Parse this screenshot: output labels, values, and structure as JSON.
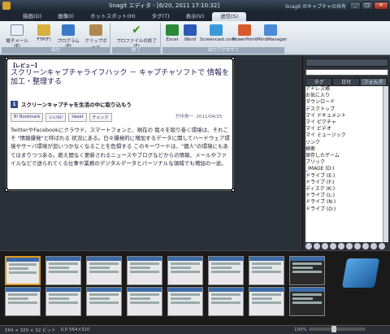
{
  "window": {
    "title": "Snagit エディタ - [6/20, 2011 17:10:32]",
    "right_text": "Snagit のキャプチャの共有",
    "minimize": "_",
    "maximize": "□",
    "close": "✕"
  },
  "tabs": [
    "描画(D)",
    "画像(I)",
    "ホットスポット(H)",
    "タグ(T)",
    "表示(V)",
    "送信(S)"
  ],
  "ribbon": {
    "groups": [
      {
        "label": "出力",
        "buttons": [
          "電子メール(E)",
          "FTP(F)",
          "プログラム(P)",
          "クリップボード"
        ]
      },
      {
        "label": "終了",
        "buttons": [
          "プロファイルの終了(F)"
        ]
      },
      {
        "label": "出力アクセサリ",
        "buttons": [
          "Excel",
          "Word",
          "Screencast.com",
          "PowerPoint",
          "MindManager"
        ]
      }
    ]
  },
  "document": {
    "tag": "【レビュー】",
    "title": "スクリーンキャプチャライフハック － キャプチャソフトで 情報を加工・整理する",
    "section_num": "1",
    "section": "スクリーンキャプチャを生活の中に取り込もう",
    "social": [
      "B! Bookmark",
      "いいね!",
      "tweet",
      "チェック"
    ],
    "author": "竹中青一",
    "date": "2011/04/25",
    "body": "TwitterやFacebookにクラウド、スマートフォンと、現在の 我々を取り巻く環境は、それこそ \"情報爆発\"と呼ばれる 状況にある。日々爆発的に増加するデータに関してハードウェア環境やサーバ環境が追いつかなくなることを危惧する このキーワードは、\"個人\"の環境にもあてはまりつつある。絶え間なく更新されるニュースやブログなどからの情報、メールやファイルなどで送られてくる仕事や業務のデジタルデータとパーソナルな領域でも増加の一途。"
  },
  "sidebar": {
    "tabs": [
      "タグ",
      "日付",
      "フォルダ"
    ],
    "items": [
      "アドレス帳",
      "お気に入り",
      "ダウンロード",
      "デスクトップ",
      "マイ ドキュメント",
      "マイ ピクチャ",
      "マイ ビデオ",
      "マイ ミュージック",
      "リンク",
      "検索",
      "保存したゲーム",
      "ブリック",
      "_IMAGE (D:)",
      "ドライブ (E:)",
      "ドライブ (F:)",
      "ディスク (K:)",
      "ドライブ (L:)",
      "ドライブ (N:)",
      "ドライブ (O:)"
    ]
  },
  "status": {
    "size": "564 × 320 × 32 ビット",
    "coords": "0,0   564×320",
    "zoom": "100%"
  },
  "colors": {
    "accent": "#e09a20",
    "ribbon_label": "#9aaabc"
  }
}
